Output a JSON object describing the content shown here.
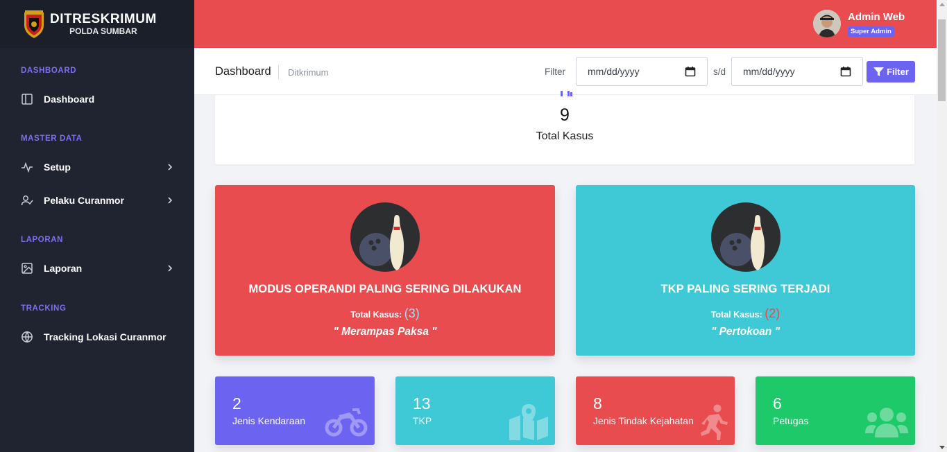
{
  "brand": {
    "title": "DITRESKRIMUM",
    "subtitle": "POLDA SUMBAR",
    "logo": "police-shield-logo"
  },
  "sidebar": {
    "sections": [
      {
        "label": "DASHBOARD",
        "items": [
          {
            "label": "Dashboard",
            "icon": "layout-icon",
            "has_children": false
          }
        ]
      },
      {
        "label": "MASTER DATA",
        "items": [
          {
            "label": "Setup",
            "icon": "activity-icon",
            "has_children": true
          },
          {
            "label": "Pelaku Curanmor",
            "icon": "user-check-icon",
            "has_children": true
          }
        ]
      },
      {
        "label": "LAPORAN",
        "items": [
          {
            "label": "Laporan",
            "icon": "image-icon",
            "has_children": true
          }
        ]
      },
      {
        "label": "TRACKING",
        "items": [
          {
            "label": "Tracking Lokasi Curanmor",
            "icon": "globe-icon",
            "has_children": false
          }
        ]
      }
    ]
  },
  "user": {
    "name": "Admin Web",
    "role": "Super Admin"
  },
  "header": {
    "title": "Dashboard",
    "breadcrumb": "Ditkrimum",
    "filter_label": "Filter",
    "date_from_placeholder": "mm/dd/yyyy",
    "separator": "s/d",
    "date_to_placeholder": "mm/dd/yyyy",
    "filter_button": "Filter"
  },
  "total": {
    "value": "9",
    "label": "Total Kasus"
  },
  "highlight_cards": [
    {
      "title": "MODUS OPERANDI PALING SERING DILAKUKAN",
      "total_label": "Total Kasus:",
      "count": "(3)",
      "value": "\" Merampas Paksa \"",
      "color": "#e84c4f"
    },
    {
      "title": "TKP PALING SERING TERJADI",
      "total_label": "Total Kasus:",
      "count": "(2)",
      "value": "\" Pertokoan \"",
      "color": "#3fc8d5"
    }
  ],
  "stats": [
    {
      "value": "2",
      "label": "Jenis Kendaraan",
      "icon": "motorcycle-icon",
      "color": "#6c63f0"
    },
    {
      "value": "13",
      "label": "TKP",
      "icon": "map-marker-icon",
      "color": "#3fc8d5"
    },
    {
      "value": "8",
      "label": "Jenis Tindak Kejahatan",
      "icon": "running-person-icon",
      "color": "#e84c4f"
    },
    {
      "value": "6",
      "label": "Petugas",
      "icon": "users-icon",
      "color": "#1ec96a"
    }
  ],
  "colors": {
    "primary": "#6c63f0",
    "danger": "#e84c4f",
    "info": "#3fc8d5",
    "success": "#1ec96a",
    "sidebar": "#1f2430"
  }
}
